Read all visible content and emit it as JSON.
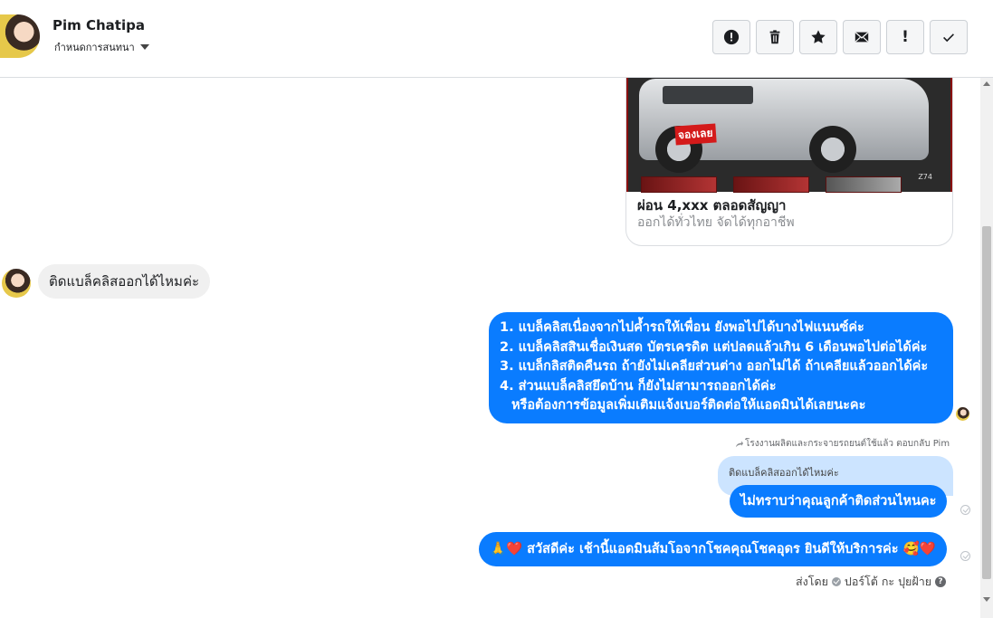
{
  "header": {
    "contact_name": "Pim Chatipa",
    "subtitle": "กำหนดการสนทนา",
    "toolbar": [
      {
        "icon": "alert-circle-icon",
        "label": ""
      },
      {
        "icon": "trash-icon",
        "label": ""
      },
      {
        "icon": "star-icon",
        "label": ""
      },
      {
        "icon": "mail-icon",
        "label": ""
      },
      {
        "icon": "exclamation-icon",
        "label": "!"
      },
      {
        "icon": "check-icon",
        "label": ""
      }
    ]
  },
  "card": {
    "image_tag": "จองเลย",
    "image_code": "Z74",
    "title": "ผ่อน 4,xxx ตลอดสัญญา",
    "subtitle": "ออกได้ทั่วไทย จัดได้ทุกอาชีพ"
  },
  "messages": {
    "incoming_1": "ติดแบล็คลิสออกได้ไหมค่ะ",
    "outgoing_answer": {
      "lines": [
        "1. แบล็คลิสเนื่องจากไปค้ำรถให้เพื่อน ยังพอไปได้บางไฟแนนซ์ค่ะ",
        "2. แบล็คลิสสินเชื่อเงินสด บัตรเครดิต แต่ปลดแล้วเกิน 6 เดือนพอไปต่อได้ค่ะ",
        "3. แบล็กลิสติดคืนรถ ถ้ายังไม่เคลียส่วนต่าง ออกไม่ได้ ถ้าเคลียแล้วออกได้ค่ะ",
        "4. ส่วนแบล็คลิสยึดบ้าน ก็ยังไม่สามารถออกได้ค่ะ",
        "หรือต้องการข้อมูลเพิ่มเติมแจ้งเบอร์ติดต่อให้แอดมินได้เลยนะคะ"
      ]
    },
    "reply_meta": "โรงงานผลิตและกระจายรถยนต์ใช้แล้ว ตอบกลับ Pim",
    "quoted_text": "ติดแบล็คลิสออกได้ไหมค่ะ",
    "reply_text": "ไม่ทราบว่าคุณลูกค้าติดส่วนไหนคะ",
    "greeting_text": "🙏❤️ สวัสดีค่ะ เช้านี้แอดมินส้มโอจากโชคคุณโชคอุดร ยินดีให้บริการค่ะ  🥰❤️",
    "sent_by_label": "ส่งโดย",
    "sent_by_name": "ปอร์โต้ กะ ปุยฝ้าย"
  },
  "colors": {
    "outgoing_bubble": "#0a7cff",
    "incoming_bubble": "#f0f0f0",
    "quoted_bubble": "#cce4ff"
  }
}
